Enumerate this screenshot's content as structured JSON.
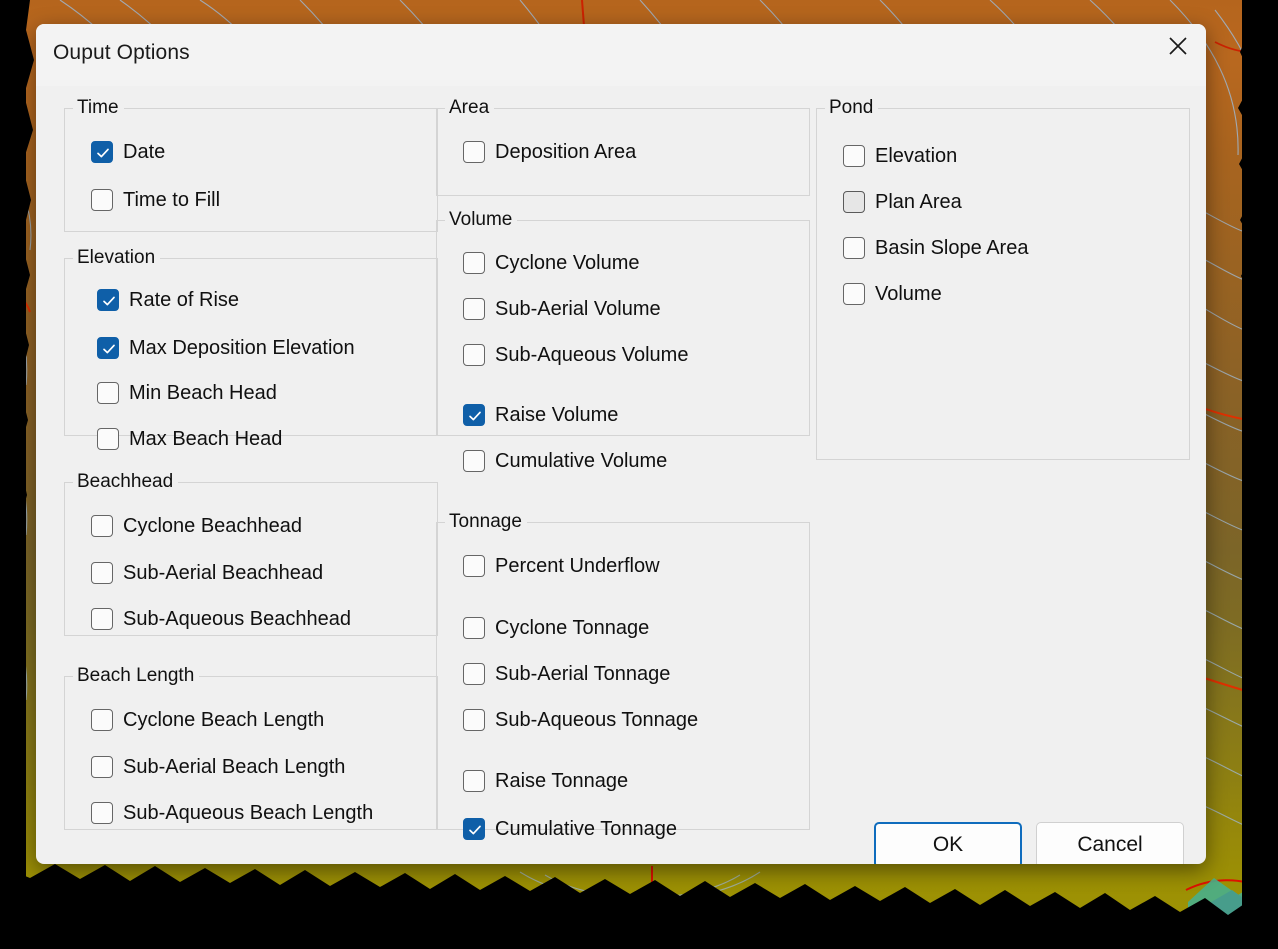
{
  "dialog": {
    "title": "Ouput Options",
    "close_icon": "close-icon",
    "accent_color": "#0f5fa8",
    "focus_border_color": "#0f6cbd",
    "surface_color": "#f0f0f0"
  },
  "columns": [
    {
      "id": "column-left",
      "groups": [
        {
          "id": "time",
          "label": "Time",
          "items": [
            {
              "label": "Date",
              "checked": true,
              "hovered": false
            },
            {
              "label": "Time to  Fill",
              "checked": false,
              "hovered": false
            }
          ]
        },
        {
          "id": "elevation",
          "label": "Elevation",
          "items": [
            {
              "label": "Rate of Rise",
              "checked": true,
              "hovered": false
            },
            {
              "label": "Max Deposition Elevation",
              "checked": true,
              "hovered": false
            },
            {
              "label": "Min Beach Head",
              "checked": false,
              "hovered": false
            },
            {
              "label": "Max Beach Head",
              "checked": false,
              "hovered": false
            }
          ]
        },
        {
          "id": "beachhead",
          "label": "Beachhead",
          "items": [
            {
              "label": "Cyclone Beachhead",
              "checked": false,
              "hovered": false
            },
            {
              "label": "Sub-Aerial Beachhead",
              "checked": false,
              "hovered": false
            },
            {
              "label": "Sub-Aqueous Beachhead",
              "checked": false,
              "hovered": false
            }
          ]
        },
        {
          "id": "beach-length",
          "label": "Beach Length",
          "items": [
            {
              "label": "Cyclone Beach Length",
              "checked": false,
              "hovered": false
            },
            {
              "label": "Sub-Aerial Beach Length",
              "checked": false,
              "hovered": false
            },
            {
              "label": "Sub-Aqueous Beach Length",
              "checked": false,
              "hovered": false
            }
          ]
        }
      ]
    },
    {
      "id": "column-middle",
      "groups": [
        {
          "id": "area",
          "label": "Area",
          "items": [
            {
              "label": "Deposition Area",
              "checked": false,
              "hovered": false
            }
          ]
        },
        {
          "id": "volume",
          "label": "Volume",
          "items": [
            {
              "label": "Cyclone Volume",
              "checked": false,
              "hovered": false
            },
            {
              "label": "Sub-Aerial Volume",
              "checked": false,
              "hovered": false
            },
            {
              "label": "Sub-Aqueous Volume",
              "checked": false,
              "hovered": false
            },
            {
              "label": "Raise Volume",
              "checked": true,
              "hovered": false
            },
            {
              "label": "Cumulative Volume",
              "checked": false,
              "hovered": false
            }
          ]
        },
        {
          "id": "tonnage",
          "label": "Tonnage",
          "items": [
            {
              "label": "Percent Underflow",
              "checked": false,
              "hovered": false
            },
            {
              "label": "Cyclone Tonnage",
              "checked": false,
              "hovered": false
            },
            {
              "label": "Sub-Aerial Tonnage",
              "checked": false,
              "hovered": false
            },
            {
              "label": "Sub-Aqueous Tonnage",
              "checked": false,
              "hovered": false
            },
            {
              "label": "Raise Tonnage",
              "checked": false,
              "hovered": false
            },
            {
              "label": "Cumulative Tonnage",
              "checked": true,
              "hovered": false
            }
          ]
        }
      ]
    },
    {
      "id": "column-right",
      "groups": [
        {
          "id": "pond",
          "label": "Pond",
          "items": [
            {
              "label": "Elevation",
              "checked": false,
              "hovered": false
            },
            {
              "label": "Plan Area",
              "checked": false,
              "hovered": true
            },
            {
              "label": "Basin Slope Area",
              "checked": false,
              "hovered": false
            },
            {
              "label": "Volume",
              "checked": false,
              "hovered": false
            }
          ]
        }
      ]
    }
  ],
  "buttons": {
    "ok": "OK",
    "cancel": "Cancel"
  }
}
